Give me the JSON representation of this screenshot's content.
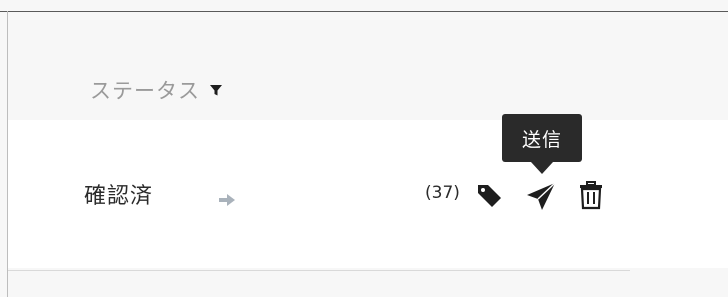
{
  "table": {
    "status_column": {
      "header_label": "ステータス",
      "filter_icon": "filter-icon"
    },
    "row": {
      "status_value": "確認済",
      "status_arrow_icon": "arrow-right-icon",
      "tag_count": "(37)",
      "actions": [
        {
          "name": "tag",
          "icon": "tag-icon"
        },
        {
          "name": "send",
          "icon": "send-icon"
        },
        {
          "name": "delete",
          "icon": "trash-icon"
        }
      ]
    }
  },
  "tooltip": {
    "text": "送信"
  },
  "colors": {
    "header_text": "#9a9a9a",
    "body_text": "#2b2b2b",
    "arrow": "#a9b2bb",
    "tooltip_bg": "#2a2a2a"
  }
}
